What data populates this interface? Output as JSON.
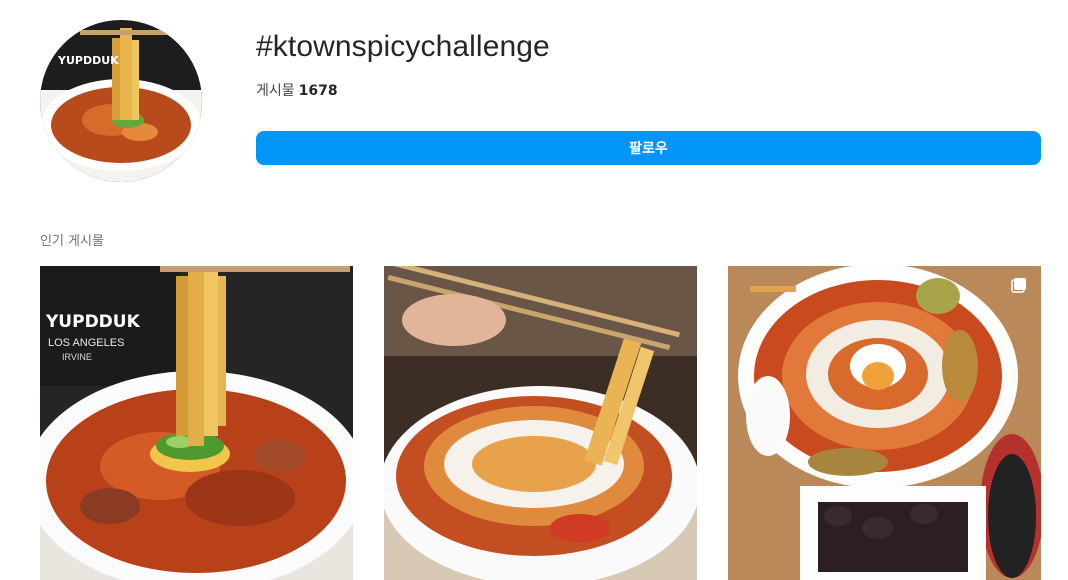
{
  "header": {
    "hashtag": "#ktownspicychallenge",
    "posts_label": "게시물",
    "posts_count": "1678",
    "follow_label": "팔로우"
  },
  "top_posts": {
    "section_label": "인기 게시물",
    "items": [
      {
        "brand_line1": "YUPDDUK",
        "brand_line2": "LOS ANGELES",
        "brand_line3": "IRVINE"
      },
      {},
      {
        "multi_photo_icon": "multi-photo-icon"
      }
    ]
  },
  "colors": {
    "follow_button": "#0095f6",
    "text_primary": "#262626",
    "text_secondary": "#737373"
  }
}
